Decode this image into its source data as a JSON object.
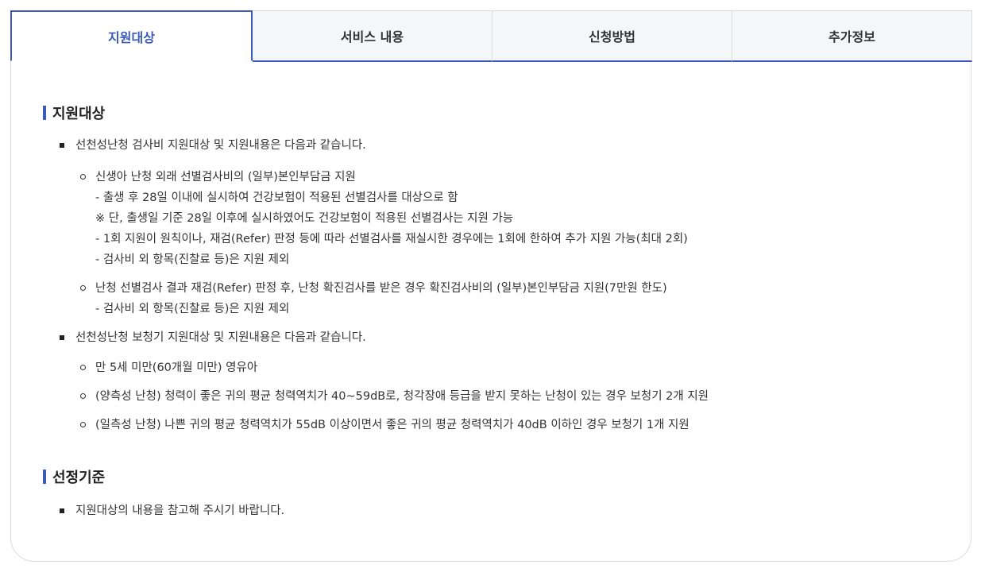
{
  "tabs": [
    {
      "label": "지원대상",
      "active": true
    },
    {
      "label": "서비스 내용",
      "active": false
    },
    {
      "label": "신청방법",
      "active": false
    },
    {
      "label": "추가정보",
      "active": false
    }
  ],
  "accent_color": "#3a5bb8",
  "section1": {
    "title": "지원대상",
    "item1": {
      "text": "선천성난청 검사비 지원대상 및 지원내용은 다음과 같습니다.",
      "sub1": {
        "lines": [
          "신생아 난청 외래 선별검사비의 (일부)본인부담금 지원",
          "- 출생 후 28일 이내에 실시하여 건강보험이 적용된 선별검사를 대상으로 함",
          "※ 단, 출생일 기준 28일 이후에 실시하였어도 건강보험이 적용된 선별검사는 지원 가능",
          "- 1회 지원이 원칙이나, 재검(Refer) 판정 등에 따라 선별검사를 재실시한 경우에는 1회에 한하여 추가 지원 가능(최대 2회)",
          "- 검사비 외 항목(진찰료 등)은 지원 제외"
        ]
      },
      "sub2": {
        "lines": [
          "난청 선별검사 결과 재검(Refer) 판정 후, 난청 확진검사를 받은 경우 확진검사비의 (일부)본인부담금 지원(7만원 한도)",
          "- 검사비 외 항목(진찰료 등)은 지원 제외"
        ]
      }
    },
    "item2": {
      "text": "선천성난청 보청기 지원대상 및 지원내용은 다음과 같습니다.",
      "subs": [
        "만 5세 미만(60개월 미만) 영유아",
        "(양측성 난청) 청력이 좋은 귀의 평균 청력역치가 40~59dB로, 청각장애 등급을 받지 못하는 난청이 있는 경우 보청기 2개 지원",
        "(일측성 난청) 나쁜 귀의 평균 청력역치가 55dB 이상이면서 좋은 귀의 평균 청력역치가 40dB 이하인 경우 보청기 1개 지원"
      ]
    }
  },
  "section2": {
    "title": "선정기준",
    "item1": "지원대상의 내용을 참고해 주시기 바랍니다."
  }
}
